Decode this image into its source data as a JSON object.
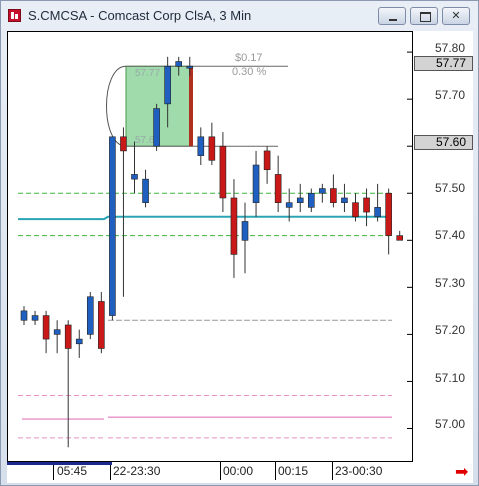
{
  "window": {
    "title": "S.CMCSA - Comcast Corp ClsA, 3 Min",
    "close_label": "✕"
  },
  "price_axis": {
    "labels": [
      "57.80",
      "57.70",
      "57.50",
      "57.40",
      "57.30",
      "57.20",
      "57.10",
      "57.00"
    ],
    "highlight_a": "57.77",
    "highlight_b": "57.60"
  },
  "measure": {
    "change": "$0.17",
    "percent": "0.30 %",
    "top_value": "57.77",
    "bottom_value": "57.60"
  },
  "time_axis": {
    "labels": [
      "05:45",
      "22-23:30",
      "00:00",
      "00:15",
      "23-00:30"
    ]
  },
  "colors": {
    "up": "#1f5fbf",
    "down": "#c81818",
    "trend": "#2aa5b5",
    "band_green": "#3cb43c",
    "band_pink": "#e890c8",
    "measure_fill": "#7fcf8f"
  },
  "chart_data": {
    "type": "candlestick",
    "y_range": [
      56.95,
      57.83
    ],
    "ohlc": [
      [
        57.23,
        57.26,
        57.22,
        57.25
      ],
      [
        57.23,
        57.25,
        57.22,
        57.24
      ],
      [
        57.24,
        57.25,
        57.16,
        57.19
      ],
      [
        57.2,
        57.23,
        57.16,
        57.21
      ],
      [
        57.22,
        57.23,
        56.96,
        57.17
      ],
      [
        57.18,
        57.21,
        57.15,
        57.19
      ],
      [
        57.2,
        57.29,
        57.19,
        57.28
      ],
      [
        57.27,
        57.29,
        57.16,
        57.17
      ],
      [
        57.24,
        57.61,
        57.23,
        57.62
      ],
      [
        57.62,
        57.64,
        57.28,
        57.59
      ],
      [
        57.53,
        57.61,
        57.5,
        57.54
      ],
      [
        57.48,
        57.55,
        57.47,
        57.53
      ],
      [
        57.6,
        57.69,
        57.59,
        57.68
      ],
      [
        57.69,
        57.79,
        57.64,
        57.77
      ],
      [
        57.77,
        57.79,
        57.75,
        57.78
      ],
      [
        57.77,
        57.79,
        57.75,
        57.77
      ],
      [
        57.58,
        57.64,
        57.56,
        57.62
      ],
      [
        57.62,
        57.65,
        57.56,
        57.57
      ],
      [
        57.6,
        57.63,
        57.46,
        57.49
      ],
      [
        57.49,
        57.53,
        57.32,
        57.37
      ],
      [
        57.4,
        57.48,
        57.33,
        57.44
      ],
      [
        57.48,
        57.59,
        57.45,
        57.56
      ],
      [
        57.59,
        57.6,
        57.52,
        57.55
      ],
      [
        57.54,
        57.58,
        57.46,
        57.48
      ],
      [
        57.47,
        57.51,
        57.44,
        57.48
      ],
      [
        57.48,
        57.52,
        57.46,
        57.49
      ],
      [
        57.47,
        57.51,
        57.46,
        57.5
      ],
      [
        57.5,
        57.52,
        57.48,
        57.51
      ],
      [
        57.51,
        57.54,
        57.47,
        57.48
      ],
      [
        57.48,
        57.52,
        57.46,
        57.49
      ],
      [
        57.48,
        57.5,
        57.44,
        57.45
      ],
      [
        57.49,
        57.51,
        57.43,
        57.46
      ],
      [
        57.45,
        57.52,
        57.44,
        57.47
      ],
      [
        57.5,
        57.51,
        57.37,
        57.41
      ],
      [
        57.41,
        57.42,
        57.4,
        57.4
      ]
    ],
    "levels": {
      "green_upper": 57.5,
      "green_lower": 57.41,
      "trend": 57.45,
      "grey": 57.23,
      "pink_upper": 57.07,
      "pink_mid": 57.02,
      "pink_lower": 56.98
    }
  }
}
